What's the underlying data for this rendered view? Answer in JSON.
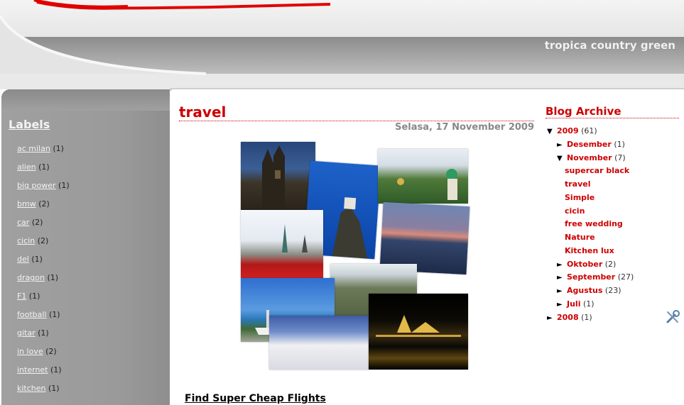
{
  "header": {
    "tagline": "tropica country green"
  },
  "sidebar": {
    "title": "Labels",
    "items": [
      {
        "label": "ac milan",
        "count": "(1)"
      },
      {
        "label": "alien",
        "count": "(1)"
      },
      {
        "label": "big power",
        "count": "(1)"
      },
      {
        "label": "bmw",
        "count": "(2)"
      },
      {
        "label": "car",
        "count": "(2)"
      },
      {
        "label": "cicin",
        "count": "(2)"
      },
      {
        "label": "del",
        "count": "(1)"
      },
      {
        "label": "dragon",
        "count": "(1)"
      },
      {
        "label": "F1",
        "count": "(1)"
      },
      {
        "label": "football",
        "count": "(1)"
      },
      {
        "label": "gitar",
        "count": "(1)"
      },
      {
        "label": "in love",
        "count": "(2)"
      },
      {
        "label": "internet",
        "count": "(1)"
      },
      {
        "label": "kitchen",
        "count": "(1)"
      }
    ]
  },
  "post": {
    "title": "travel",
    "date": "Selasa, 17 November 2009",
    "link": "Find Super Cheap Flights"
  },
  "archive": {
    "title": "Blog Archive",
    "year_2009": {
      "toggle": "▼",
      "label": "2009",
      "count": "(61)"
    },
    "desember": {
      "toggle": "►",
      "label": "Desember",
      "count": "(1)"
    },
    "november": {
      "toggle": "▼",
      "label": "November",
      "count": "(7)"
    },
    "posts": [
      "supercar black",
      "travel",
      "Simple",
      "cicin",
      "free wedding",
      "Nature",
      "Kitchen lux"
    ],
    "oktober": {
      "toggle": "►",
      "label": "Oktober",
      "count": "(2)"
    },
    "september": {
      "toggle": "►",
      "label": "September",
      "count": "(27)"
    },
    "agustus": {
      "toggle": "►",
      "label": "Agustus",
      "count": "(23)"
    },
    "juli": {
      "toggle": "►",
      "label": "Juli",
      "count": "(1)"
    },
    "year_2008": {
      "toggle": "►",
      "label": "2008",
      "count": "(1)"
    }
  },
  "icons": {
    "tools": "wrench-screwdriver-icon"
  },
  "colors": {
    "accent": "#cc0000",
    "sidebar": "#9a9a9a"
  }
}
